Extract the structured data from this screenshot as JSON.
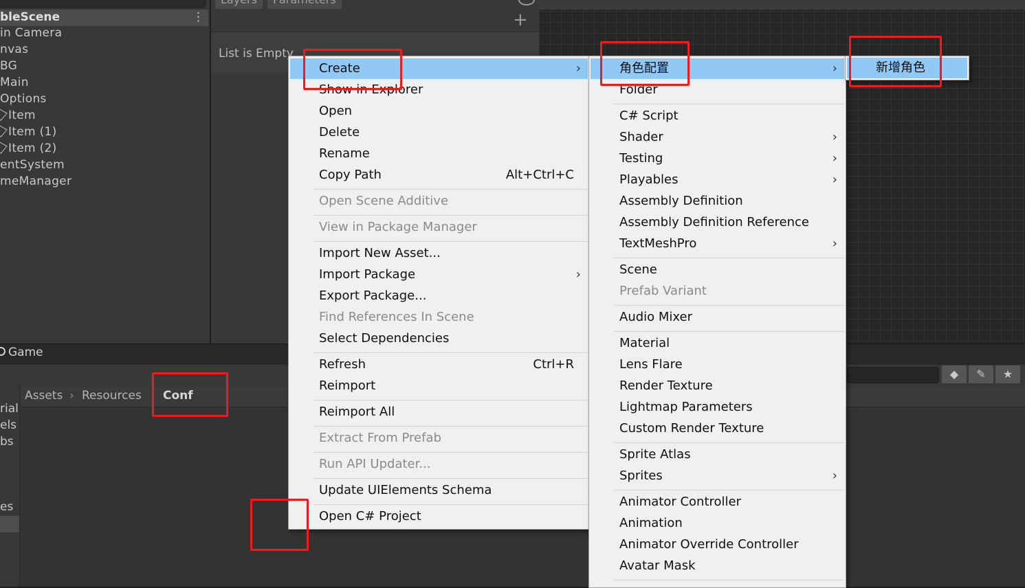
{
  "hierarchy": {
    "scene_name": "bleScene",
    "items": [
      {
        "label": "in Camera",
        "icon": false
      },
      {
        "label": "nvas",
        "icon": false
      },
      {
        "label": "BG",
        "icon": false
      },
      {
        "label": "Main",
        "icon": false
      },
      {
        "label": "Options",
        "icon": false
      },
      {
        "label": "Item",
        "icon": true
      },
      {
        "label": "Item (1)",
        "icon": true
      },
      {
        "label": "Item (2)",
        "icon": true
      },
      {
        "label": "entSystem",
        "icon": false
      },
      {
        "label": "meManager",
        "icon": false
      }
    ]
  },
  "animator": {
    "tabs": [
      "Layers",
      "Parameters"
    ],
    "empty_text": "List is Empty",
    "add_icon": "plus-icon"
  },
  "game_tab": {
    "label": "Game",
    "icon": "game-icon"
  },
  "project": {
    "breadcrumb": [
      "Assets",
      "Resources",
      "Conf"
    ],
    "tree_items": [
      "rial",
      "els",
      "bs",
      "es"
    ],
    "toolbar_icons": [
      "filter-by-type-icon",
      "label-tag-icon",
      "favorite-star-icon"
    ]
  },
  "menu_main": {
    "items": [
      {
        "label": "Create",
        "submenu": true,
        "highlighted": true
      },
      {
        "label": "Show in Explorer"
      },
      {
        "label": "Open"
      },
      {
        "label": "Delete"
      },
      {
        "label": "Rename"
      },
      {
        "label": "Copy Path",
        "shortcut": "Alt+Ctrl+C"
      },
      {
        "separator": true
      },
      {
        "label": "Open Scene Additive",
        "disabled": true
      },
      {
        "separator": true
      },
      {
        "label": "View in Package Manager",
        "disabled": true
      },
      {
        "separator": true
      },
      {
        "label": "Import New Asset..."
      },
      {
        "label": "Import Package",
        "submenu": true
      },
      {
        "label": "Export Package..."
      },
      {
        "label": "Find References In Scene",
        "disabled": true
      },
      {
        "label": "Select Dependencies"
      },
      {
        "separator": true
      },
      {
        "label": "Refresh",
        "shortcut": "Ctrl+R"
      },
      {
        "label": "Reimport"
      },
      {
        "separator": true
      },
      {
        "label": "Reimport All"
      },
      {
        "separator": true
      },
      {
        "label": "Extract From Prefab",
        "disabled": true
      },
      {
        "separator": true
      },
      {
        "label": "Run API Updater...",
        "disabled": true
      },
      {
        "separator": true
      },
      {
        "label": "Update UIElements Schema"
      },
      {
        "separator": true
      },
      {
        "label": "Open C# Project"
      }
    ]
  },
  "menu_create": {
    "items": [
      {
        "label": "角色配置",
        "submenu": true,
        "highlighted": true
      },
      {
        "label": "Folder"
      },
      {
        "separator": true
      },
      {
        "label": "C# Script"
      },
      {
        "label": "Shader",
        "submenu": true
      },
      {
        "label": "Testing",
        "submenu": true
      },
      {
        "label": "Playables",
        "submenu": true
      },
      {
        "label": "Assembly Definition"
      },
      {
        "label": "Assembly Definition Reference"
      },
      {
        "label": "TextMeshPro",
        "submenu": true
      },
      {
        "separator": true
      },
      {
        "label": "Scene"
      },
      {
        "label": "Prefab Variant",
        "disabled": true
      },
      {
        "separator": true
      },
      {
        "label": "Audio Mixer"
      },
      {
        "separator": true
      },
      {
        "label": "Material"
      },
      {
        "label": "Lens Flare"
      },
      {
        "label": "Render Texture"
      },
      {
        "label": "Lightmap Parameters"
      },
      {
        "label": "Custom Render Texture"
      },
      {
        "separator": true
      },
      {
        "label": "Sprite Atlas"
      },
      {
        "label": "Sprites",
        "submenu": true
      },
      {
        "separator": true
      },
      {
        "label": "Animator Controller"
      },
      {
        "label": "Animation"
      },
      {
        "label": "Animator Override Controller"
      },
      {
        "label": "Avatar Mask"
      },
      {
        "separator": true
      }
    ]
  },
  "menu_role": {
    "items": [
      {
        "label": "新增角色",
        "highlighted": true
      }
    ]
  },
  "colors": {
    "menu_bg": "#f0f0f0",
    "menu_highlight": "#90c8f6",
    "annotation_red": "#f21a1a",
    "editor_dark": "#383838"
  }
}
